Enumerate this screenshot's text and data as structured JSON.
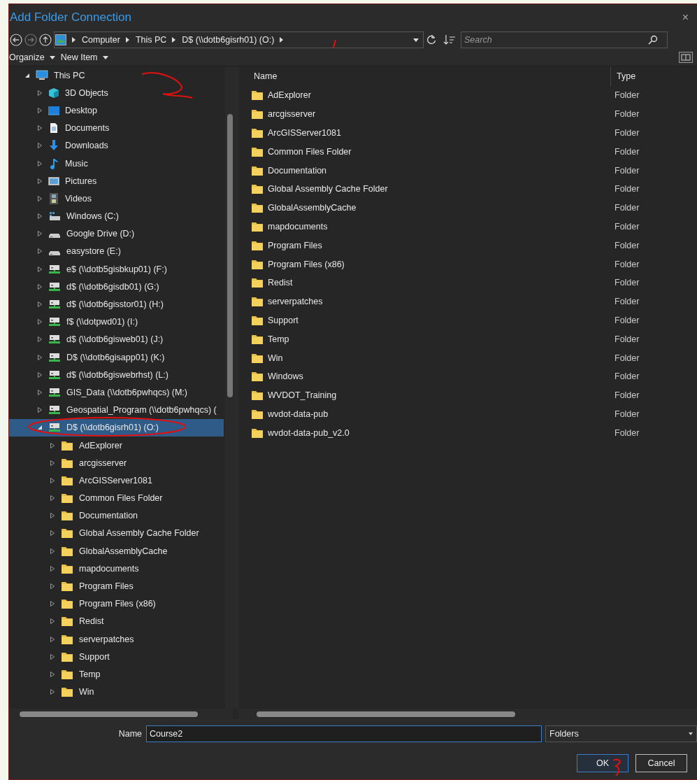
{
  "window": {
    "title": "Add Folder Connection",
    "close": "×"
  },
  "address_bar": {
    "breadcrumbs": [
      "Computer",
      "This PC",
      "D$ (\\\\dotb6gisrh01) (O:)"
    ]
  },
  "search": {
    "placeholder": "Search"
  },
  "toolbar": {
    "items": [
      "Organize",
      "New Item"
    ]
  },
  "tree": [
    {
      "label": "This PC",
      "kind": "computer",
      "expanded": true,
      "selected": false,
      "children": [
        {
          "label": "3D Objects",
          "kind": "objects3d",
          "expanded": false,
          "selected": false
        },
        {
          "label": "Desktop",
          "kind": "desktop",
          "expanded": false,
          "selected": false
        },
        {
          "label": "Documents",
          "kind": "documents",
          "expanded": false,
          "selected": false
        },
        {
          "label": "Downloads",
          "kind": "downloads",
          "expanded": false,
          "selected": false
        },
        {
          "label": "Music",
          "kind": "music",
          "expanded": false,
          "selected": false
        },
        {
          "label": "Pictures",
          "kind": "pictures",
          "expanded": false,
          "selected": false
        },
        {
          "label": "Videos",
          "kind": "videos",
          "expanded": false,
          "selected": false
        },
        {
          "label": "Windows (C:)",
          "kind": "system-drive",
          "expanded": false,
          "selected": false
        },
        {
          "label": "Google Drive (D:)",
          "kind": "drive",
          "expanded": false,
          "selected": false
        },
        {
          "label": "easystore (E:)",
          "kind": "drive",
          "expanded": false,
          "selected": false
        },
        {
          "label": "e$ (\\\\dotb5gisbkup01) (F:)",
          "kind": "network-drive",
          "expanded": false,
          "selected": false
        },
        {
          "label": "d$ (\\\\dotb6gisdb01) (G:)",
          "kind": "network-drive",
          "expanded": false,
          "selected": false
        },
        {
          "label": "d$ (\\\\dotb6gisstor01) (H:)",
          "kind": "network-drive",
          "expanded": false,
          "selected": false
        },
        {
          "label": "f$ (\\\\dotpwd01) (I:)",
          "kind": "network-drive",
          "expanded": false,
          "selected": false
        },
        {
          "label": "d$ (\\\\dotb6gisweb01) (J:)",
          "kind": "network-drive",
          "expanded": false,
          "selected": false
        },
        {
          "label": "D$ (\\\\dotb6gisapp01) (K:)",
          "kind": "network-drive",
          "expanded": false,
          "selected": false
        },
        {
          "label": "d$ (\\\\dotb6giswebrhst) (L:)",
          "kind": "network-drive",
          "expanded": false,
          "selected": false
        },
        {
          "label": "GIS_Data (\\\\dotb6pwhqcs) (M:)",
          "kind": "network-drive",
          "expanded": false,
          "selected": false
        },
        {
          "label": "Geospatial_Program (\\\\dotb6pwhqcs) (",
          "kind": "network-drive",
          "expanded": false,
          "selected": false
        },
        {
          "label": "D$ (\\\\dotb6gisrh01) (O:)",
          "kind": "network-drive",
          "expanded": true,
          "selected": true,
          "children": [
            {
              "label": "AdExplorer",
              "kind": "folder",
              "expanded": false,
              "selected": false
            },
            {
              "label": "arcgisserver",
              "kind": "folder",
              "expanded": false,
              "selected": false
            },
            {
              "label": "ArcGISServer1081",
              "kind": "folder",
              "expanded": false,
              "selected": false
            },
            {
              "label": "Common Files Folder",
              "kind": "folder",
              "expanded": false,
              "selected": false
            },
            {
              "label": "Documentation",
              "kind": "folder",
              "expanded": false,
              "selected": false
            },
            {
              "label": "Global Assembly Cache Folder",
              "kind": "folder",
              "expanded": false,
              "selected": false
            },
            {
              "label": "GlobalAssemblyCache",
              "kind": "folder",
              "expanded": false,
              "selected": false
            },
            {
              "label": "mapdocuments",
              "kind": "folder",
              "expanded": false,
              "selected": false
            },
            {
              "label": "Program Files",
              "kind": "folder",
              "expanded": false,
              "selected": false
            },
            {
              "label": "Program Files (x86)",
              "kind": "folder",
              "expanded": false,
              "selected": false
            },
            {
              "label": "Redist",
              "kind": "folder",
              "expanded": false,
              "selected": false
            },
            {
              "label": "serverpatches",
              "kind": "folder",
              "expanded": false,
              "selected": false
            },
            {
              "label": "Support",
              "kind": "folder",
              "expanded": false,
              "selected": false
            },
            {
              "label": "Temp",
              "kind": "folder",
              "expanded": false,
              "selected": false
            },
            {
              "label": "Win",
              "kind": "folder",
              "expanded": false,
              "selected": false
            }
          ]
        }
      ]
    }
  ],
  "file_list": {
    "columns": [
      "Name",
      "Type"
    ],
    "rows": [
      {
        "name": "AdExplorer",
        "type": "Folder"
      },
      {
        "name": "arcgisserver",
        "type": "Folder"
      },
      {
        "name": "ArcGISServer1081",
        "type": "Folder"
      },
      {
        "name": "Common Files Folder",
        "type": "Folder"
      },
      {
        "name": "Documentation",
        "type": "Folder"
      },
      {
        "name": "Global Assembly Cache Folder",
        "type": "Folder"
      },
      {
        "name": "GlobalAssemblyCache",
        "type": "Folder"
      },
      {
        "name": "mapdocuments",
        "type": "Folder"
      },
      {
        "name": "Program Files",
        "type": "Folder"
      },
      {
        "name": "Program Files (x86)",
        "type": "Folder"
      },
      {
        "name": "Redist",
        "type": "Folder"
      },
      {
        "name": "serverpatches",
        "type": "Folder"
      },
      {
        "name": "Support",
        "type": "Folder"
      },
      {
        "name": "Temp",
        "type": "Folder"
      },
      {
        "name": "Win",
        "type": "Folder"
      },
      {
        "name": "Windows",
        "type": "Folder"
      },
      {
        "name": "WVDOT_Training",
        "type": "Folder"
      },
      {
        "name": "wvdot-data-pub",
        "type": "Folder"
      },
      {
        "name": "wvdot-data-pub_v2.0",
        "type": "Folder"
      }
    ]
  },
  "footer": {
    "name_label": "Name",
    "name_value": "Course2",
    "filter": "Folders",
    "buttons": [
      {
        "label": "OK",
        "kind": "default"
      },
      {
        "label": "Cancel",
        "kind": "normal"
      }
    ]
  }
}
